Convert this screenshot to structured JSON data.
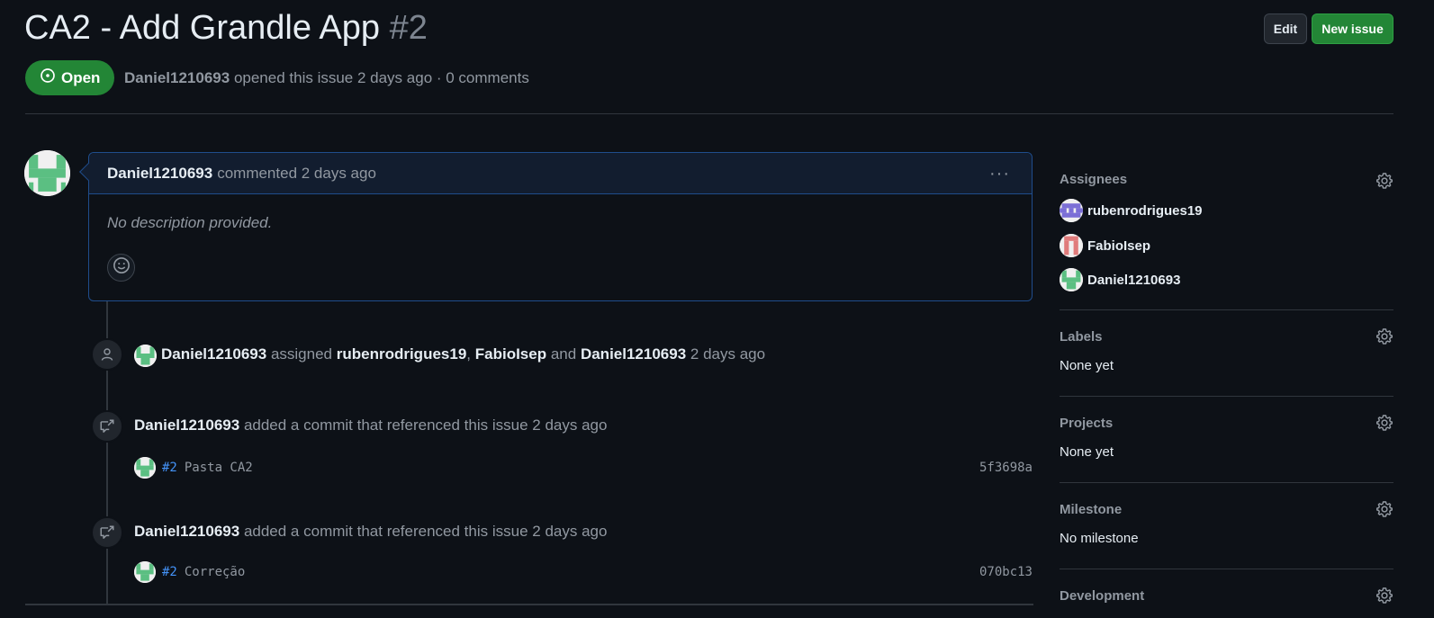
{
  "issue": {
    "title": "CA2 - Add Grandle App",
    "number": "#2",
    "state": "Open",
    "author": "Daniel1210693",
    "opened_text": "opened this issue 2 days ago · 0 comments"
  },
  "header_buttons": {
    "edit": "Edit",
    "new_issue": "New issue"
  },
  "comment": {
    "author": "Daniel1210693",
    "meta": "commented 2 days ago",
    "body": "No description provided.",
    "menu": "···"
  },
  "timeline": {
    "assign": {
      "actor": "Daniel1210693",
      "verb": "assigned",
      "user1": "rubenrodrigues19",
      "sep1": ",",
      "user2": "FabioIsep",
      "sep2": "and",
      "user3": "Daniel1210693",
      "time": "2 days ago"
    },
    "events": [
      {
        "actor": "Daniel1210693",
        "text": "added a commit that referenced this issue 2 days ago",
        "ref": "#2",
        "message": "Pasta CA2",
        "sha": "5f3698a"
      },
      {
        "actor": "Daniel1210693",
        "text": "added a commit that referenced this issue 2 days ago",
        "ref": "#2",
        "message": "Correção",
        "sha": "070bc13"
      }
    ]
  },
  "sidebar": {
    "assignees": {
      "heading": "Assignees",
      "items": [
        "rubenrodrigues19",
        "FabioIsep",
        "Daniel1210693"
      ]
    },
    "labels": {
      "heading": "Labels",
      "value": "None yet"
    },
    "projects": {
      "heading": "Projects",
      "value": "None yet"
    },
    "milestone": {
      "heading": "Milestone",
      "value": "No milestone"
    },
    "development": {
      "heading": "Development"
    }
  },
  "colors": {
    "background": "#0d1117",
    "open_green": "#238636",
    "link_blue": "#4493f8",
    "muted": "#9198a1"
  },
  "icons": [
    "issue-opened-icon",
    "kebab-horizontal-icon",
    "smiley-icon",
    "person-icon",
    "cross-reference-icon",
    "gear-icon"
  ]
}
